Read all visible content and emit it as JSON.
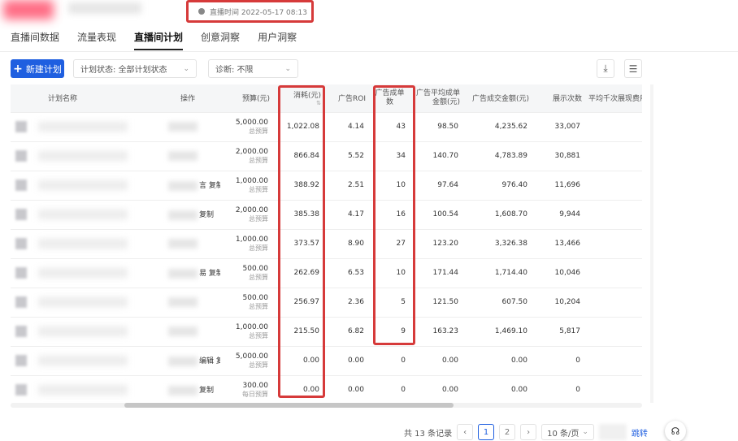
{
  "header": {
    "live_time": "直播时间  2022-05-17 08:13"
  },
  "tabs": [
    {
      "label": "直播间数据",
      "active": false
    },
    {
      "label": "流量表现",
      "active": false
    },
    {
      "label": "直播间计划",
      "active": true
    },
    {
      "label": "创意洞察",
      "active": false
    },
    {
      "label": "用户洞察",
      "active": false
    }
  ],
  "toolbar": {
    "new_plan_label": "新建计划",
    "status_select": "计划状态:  全部计划状态",
    "diagnosis_select": "诊断:  不限"
  },
  "table": {
    "columns": [
      "计划名称",
      "操作",
      "预算(元)",
      "消耗(元)",
      "广告ROI",
      "广告成单数",
      "广告平均成单金额(元)",
      "广告成交金额(元)",
      "展示次数",
      "平均千次展现费用(元)"
    ],
    "rows": [
      {
        "op": "",
        "budget": "5,000.00",
        "budget_type": "总预算",
        "cost": "1,022.08",
        "roi": "4.14",
        "orders": "43",
        "avg": "98.50",
        "gmv": "4,235.62",
        "shows": "33,007"
      },
      {
        "op": "",
        "budget": "2,000.00",
        "budget_type": "总预算",
        "cost": "866.84",
        "roi": "5.52",
        "orders": "34",
        "avg": "140.70",
        "gmv": "4,783.89",
        "shows": "30,881"
      },
      {
        "op": "言  复制",
        "budget": "1,000.00",
        "budget_type": "总预算",
        "cost": "388.92",
        "roi": "2.51",
        "orders": "10",
        "avg": "97.64",
        "gmv": "976.40",
        "shows": "11,696"
      },
      {
        "op": "复制",
        "budget": "2,000.00",
        "budget_type": "总预算",
        "cost": "385.38",
        "roi": "4.17",
        "orders": "16",
        "avg": "100.54",
        "gmv": "1,608.70",
        "shows": "9,944"
      },
      {
        "op": "",
        "budget": "1,000.00",
        "budget_type": "总预算",
        "cost": "373.57",
        "roi": "8.90",
        "orders": "27",
        "avg": "123.20",
        "gmv": "3,326.38",
        "shows": "13,466"
      },
      {
        "op": "易  复制",
        "budget": "500.00",
        "budget_type": "总预算",
        "cost": "262.69",
        "roi": "6.53",
        "orders": "10",
        "avg": "171.44",
        "gmv": "1,714.40",
        "shows": "10,046"
      },
      {
        "op": "",
        "budget": "500.00",
        "budget_type": "总预算",
        "cost": "256.97",
        "roi": "2.36",
        "orders": "5",
        "avg": "121.50",
        "gmv": "607.50",
        "shows": "10,204"
      },
      {
        "op": "",
        "budget": "1,000.00",
        "budget_type": "总预算",
        "cost": "215.50",
        "roi": "6.82",
        "orders": "9",
        "avg": "163.23",
        "gmv": "1,469.10",
        "shows": "5,817"
      },
      {
        "op": "编辑  复制",
        "budget": "5,000.00",
        "budget_type": "总预算",
        "cost": "0.00",
        "roi": "0.00",
        "orders": "0",
        "avg": "0.00",
        "gmv": "0.00",
        "shows": "0"
      },
      {
        "op": "复制",
        "budget": "300.00",
        "budget_type": "每日预算",
        "cost": "0.00",
        "roi": "0.00",
        "orders": "0",
        "avg": "0.00",
        "gmv": "0.00",
        "shows": "0"
      }
    ]
  },
  "pagination": {
    "total": "共 13 条记录",
    "pages": [
      "1",
      "2"
    ],
    "current": "1",
    "page_size": "10 条/页",
    "jump": "跳转"
  },
  "colors": {
    "accent": "#1f5fe0",
    "highlight": "#d63a3a"
  }
}
